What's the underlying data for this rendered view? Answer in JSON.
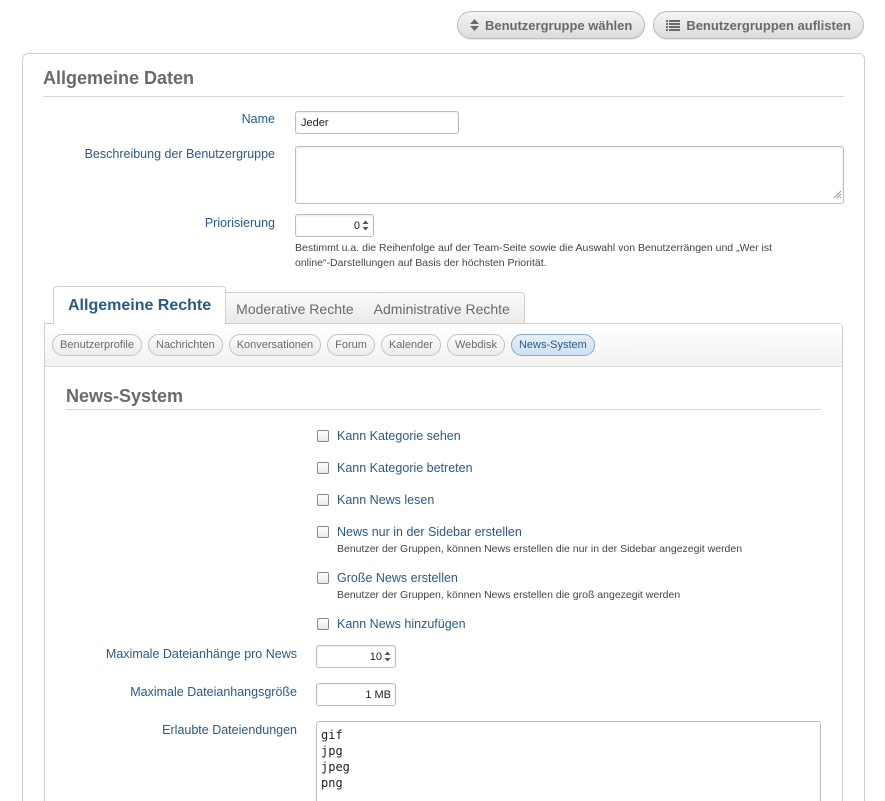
{
  "toolbar": {
    "choose_group": "Benutzergruppe wählen",
    "list_groups": "Benutzergruppen auflisten"
  },
  "general": {
    "title": "Allgemeine Daten",
    "name_label": "Name",
    "name_value": "Jeder",
    "description_label": "Beschreibung der Benutzergruppe",
    "description_value": "",
    "priority_label": "Priorisierung",
    "priority_value": "0",
    "priority_help_line1": "Bestimmt u.a. die Reihenfolge auf der Team-Seite sowie die Auswahl von Benutzerrängen und „Wer ist",
    "priority_help_line2": "online“-Darstellungen auf Basis der höchsten Priorität."
  },
  "tabs": [
    {
      "label": "Allgemeine Rechte",
      "active": true
    },
    {
      "label": "Moderative Rechte",
      "active": false
    },
    {
      "label": "Administrative Rechte",
      "active": false
    }
  ],
  "subtabs": [
    {
      "label": "Benutzerprofile",
      "active": false
    },
    {
      "label": "Nachrichten",
      "active": false
    },
    {
      "label": "Konversationen",
      "active": false
    },
    {
      "label": "Forum",
      "active": false
    },
    {
      "label": "Kalender",
      "active": false
    },
    {
      "label": "Webdisk",
      "active": false
    },
    {
      "label": "News-System",
      "active": true
    }
  ],
  "news": {
    "title": "News-System",
    "options": [
      {
        "label": "Kann Kategorie sehen",
        "checked": false,
        "desc": ""
      },
      {
        "label": "Kann Kategorie betreten",
        "checked": false,
        "desc": ""
      },
      {
        "label": "Kann News lesen",
        "checked": false,
        "desc": ""
      },
      {
        "label": "News nur in der Sidebar erstellen",
        "checked": false,
        "desc": "Benutzer der Gruppen, können News erstellen die nur in der Sidebar angezegit werden"
      },
      {
        "label": "Große News erstellen",
        "checked": false,
        "desc": "Benutzer der Gruppen, können News erstellen die groß angezegit werden"
      },
      {
        "label": "Kann News hinzufügen",
        "checked": false,
        "desc": ""
      }
    ],
    "max_attachments_label": "Maximale Dateianhänge pro News",
    "max_attachments_value": "10",
    "max_size_label": "Maximale Dateianhangsgröße",
    "max_size_value": "1 MB",
    "extensions_label": "Erlaubte Dateiendungen",
    "extensions": [
      "gif",
      "jpg",
      "jpeg",
      "png"
    ]
  },
  "colors": {
    "label_blue": "#2a5a86",
    "heading_gray": "#6a6a6a",
    "active_pill_bg": "#cfe0f1"
  }
}
